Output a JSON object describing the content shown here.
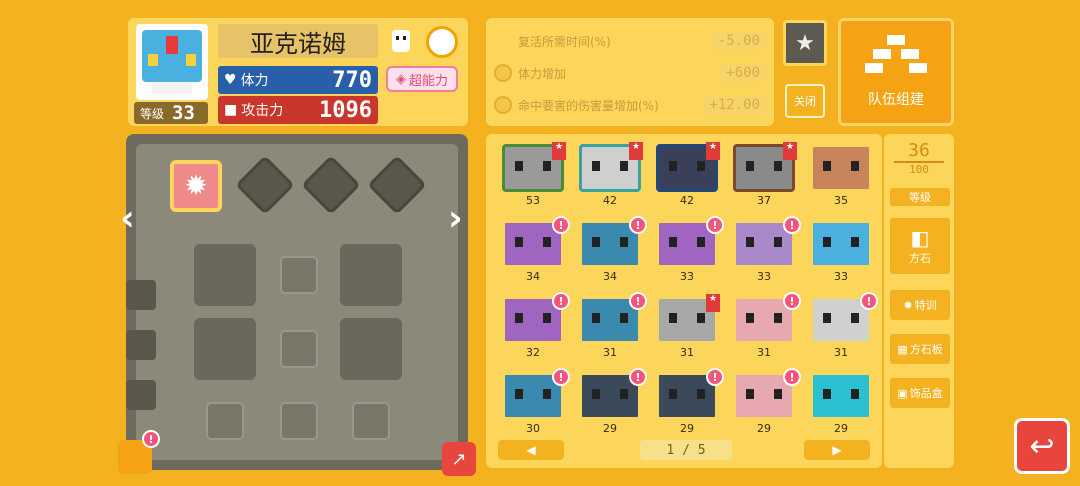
{
  "pokemon": {
    "name": "亚克诺姆",
    "level_label": "等级",
    "level": "33",
    "hp_label": "体力",
    "hp": "770",
    "atk_label": "攻击力",
    "atk": "1096",
    "super_label": "超能力"
  },
  "bonuses": [
    {
      "label": "复活所需时间(%)",
      "value": "-5.00"
    },
    {
      "label": "体力增加",
      "value": "+600"
    },
    {
      "label": "命中要害的伤害量增加(%)",
      "value": "+12.00"
    }
  ],
  "buttons": {
    "close": "关闭",
    "team": "队伍组建",
    "level_sort": "等级",
    "stone": "方石",
    "training": "特训",
    "stone_board": "方石板",
    "decor_box": "饰品盒",
    "page_prev": "◀",
    "page_next": "▶"
  },
  "count": {
    "current": "36",
    "max": "100"
  },
  "page": "1 / 5",
  "inventory": [
    {
      "level": "53",
      "color": "#9a9a9a",
      "bg": "#4a8a3a",
      "ribbon": true,
      "badge": false
    },
    {
      "level": "42",
      "color": "#cfcfcf",
      "bg": "#3aa0a0",
      "ribbon": true,
      "badge": false
    },
    {
      "level": "42",
      "color": "#3a3f5a",
      "bg": "#1e4a7a",
      "ribbon": true,
      "badge": false
    },
    {
      "level": "37",
      "color": "#8a8a8a",
      "bg": "#7a4a2a",
      "ribbon": true,
      "badge": false
    },
    {
      "level": "35",
      "color": "#c7835a",
      "bg": "#fcd65a",
      "ribbon": false,
      "badge": false
    },
    {
      "level": "34",
      "color": "#a065c0",
      "bg": "#fcd65a",
      "ribbon": false,
      "badge": true
    },
    {
      "level": "34",
      "color": "#3a8ab0",
      "bg": "#fcd65a",
      "ribbon": false,
      "badge": true
    },
    {
      "level": "33",
      "color": "#a065c0",
      "bg": "#fcd65a",
      "ribbon": false,
      "badge": true
    },
    {
      "level": "33",
      "color": "#a989c9",
      "bg": "#fcd65a",
      "ribbon": false,
      "badge": true
    },
    {
      "level": "33",
      "color": "#4ab0e0",
      "bg": "#fcd65a",
      "ribbon": false,
      "badge": false
    },
    {
      "level": "32",
      "color": "#a065c0",
      "bg": "#fcd65a",
      "ribbon": false,
      "badge": true
    },
    {
      "level": "31",
      "color": "#3a8ab0",
      "bg": "#fcd65a",
      "ribbon": false,
      "badge": true
    },
    {
      "level": "31",
      "color": "#a8a8a8",
      "bg": "#fcd65a",
      "ribbon": true,
      "badge": false
    },
    {
      "level": "31",
      "color": "#e8a8b0",
      "bg": "#fcd65a",
      "ribbon": false,
      "badge": true
    },
    {
      "level": "31",
      "color": "#d0d0d0",
      "bg": "#fcd65a",
      "ribbon": false,
      "badge": true
    },
    {
      "level": "30",
      "color": "#3a8ab0",
      "bg": "#fcd65a",
      "ribbon": false,
      "badge": true
    },
    {
      "level": "29",
      "color": "#3a4a5a",
      "bg": "#fcd65a",
      "ribbon": false,
      "badge": true
    },
    {
      "level": "29",
      "color": "#3a4a5a",
      "bg": "#fcd65a",
      "ribbon": false,
      "badge": true
    },
    {
      "level": "29",
      "color": "#e8a8b0",
      "bg": "#fcd65a",
      "ribbon": false,
      "badge": true
    },
    {
      "level": "29",
      "color": "#2ac0d0",
      "bg": "#fcd65a",
      "ribbon": false,
      "badge": false
    }
  ]
}
